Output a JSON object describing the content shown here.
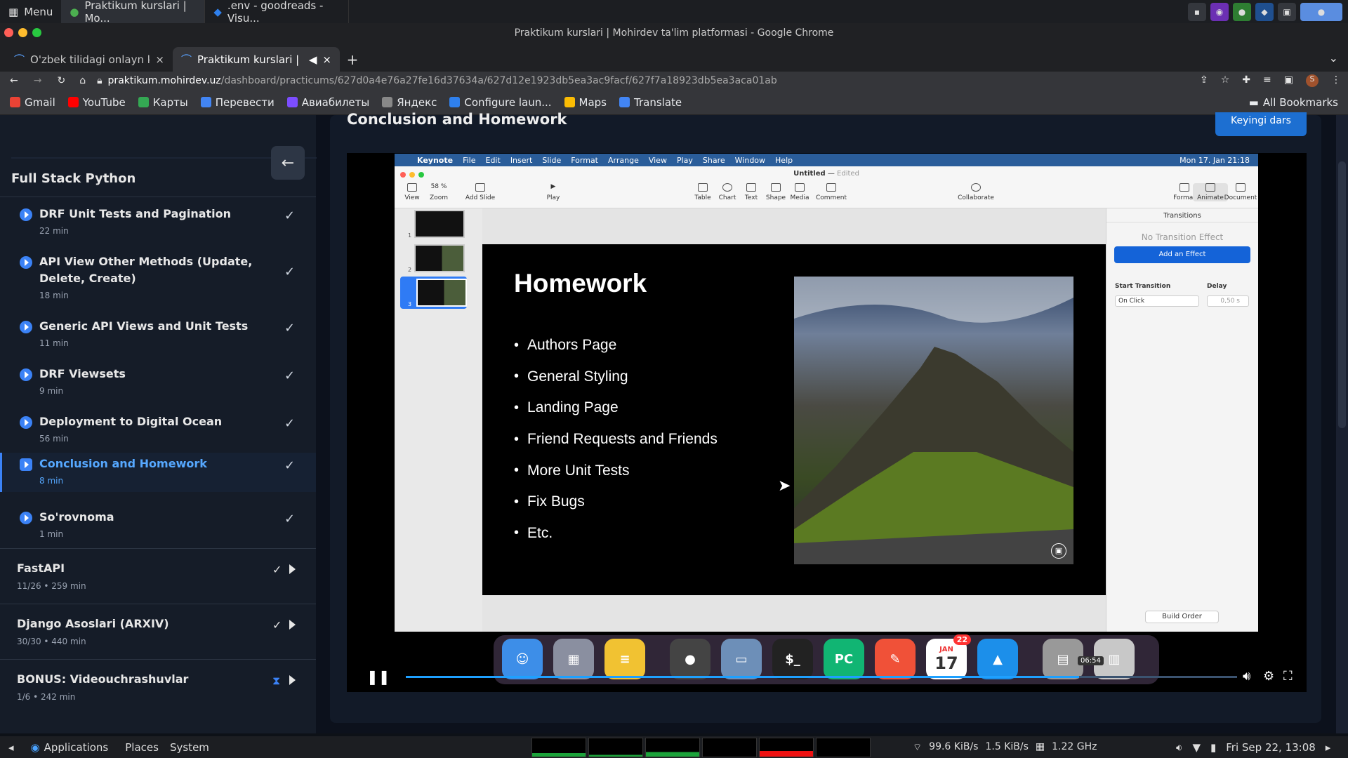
{
  "os_panel": {
    "menu_label": "Menu",
    "tasks": [
      "Praktikum kurslari | Mo...",
      ".env - goodreads - Visu..."
    ]
  },
  "window_title": "Praktikum kurslari | Mohirdev ta'lim platformasi - Google Chrome",
  "tabs": [
    {
      "label": "O'zbek tilidagi onlayn kur",
      "close": "×"
    },
    {
      "label": "Praktikum kurslari | M",
      "close": "×"
    }
  ],
  "new_tab": "+",
  "address": {
    "host": "praktikum.mohirdev.uz",
    "path": "/dashboard/practicums/627d0a4e76a27fe16d37634a/627d12e1923db5ea3ac9facf/627f7a18923db5ea3aca01ab"
  },
  "bookmarks": [
    {
      "label": "Gmail",
      "color": "#ea4335"
    },
    {
      "label": "YouTube",
      "color": "#ff0000"
    },
    {
      "label": "Карты",
      "color": "#34a853"
    },
    {
      "label": "Перевести",
      "color": "#4285f4"
    },
    {
      "label": "Авиабилеты",
      "color": "#7c4dff"
    },
    {
      "label": "Яндекс",
      "color": "#888888"
    },
    {
      "label": "Configure laun...",
      "color": "#2f80ed"
    },
    {
      "label": "Maps",
      "color": "#fbbc04"
    },
    {
      "label": "Translate",
      "color": "#4285f4"
    }
  ],
  "all_bookmarks": "All Bookmarks",
  "sidebar": {
    "title": "Full Stack Python",
    "lessons": [
      {
        "title": "DRF Unit Tests and Pagination",
        "duration": "22 min"
      },
      {
        "title": "API View Other Methods (Update, Delete, Create)",
        "duration": "18 min"
      },
      {
        "title": "Generic API Views and Unit Tests",
        "duration": "11 min"
      },
      {
        "title": "DRF Viewsets",
        "duration": "9 min"
      },
      {
        "title": "Deployment to Digital Ocean",
        "duration": "56 min"
      },
      {
        "title": "Conclusion and Homework",
        "duration": "8 min",
        "active": true
      },
      {
        "title": "So'rovnoma",
        "duration": "1 min"
      }
    ],
    "sections": [
      {
        "title": "FastAPI",
        "meta": "11/26 • 259 min",
        "mark": "✓"
      },
      {
        "title": "Django Asoslari (ARXIV)",
        "meta": "30/30 • 440 min",
        "mark": "✓"
      },
      {
        "title": "BONUS: Videouchrashuvlar",
        "meta": "1/6 • 242 min",
        "mark": "⧗"
      }
    ]
  },
  "main": {
    "heading": "Conclusion and Homework",
    "next_button": "Keyingi dars"
  },
  "keynote": {
    "menubar": [
      "Keynote",
      "File",
      "Edit",
      "Insert",
      "Slide",
      "Format",
      "Arrange",
      "View",
      "Play",
      "Share",
      "Window",
      "Help"
    ],
    "clock": "Mon 17. Jan 21:18",
    "doc_title": "Untitled",
    "doc_state": "Edited",
    "toolbar": {
      "view": "View",
      "zoom_value": "58 %",
      "zoom": "Zoom",
      "add_slide": "Add Slide",
      "play": "Play",
      "table": "Table",
      "chart": "Chart",
      "text": "Text",
      "shape": "Shape",
      "media": "Media",
      "comment": "Comment",
      "collaborate": "Collaborate",
      "format": "Format",
      "animate": "Animate",
      "document": "Document"
    },
    "slide": {
      "title": "Homework",
      "bullets": [
        "Authors Page",
        "General Styling",
        "Landing Page",
        "Friend Requests and Friends",
        "More Unit Tests",
        "Fix Bugs",
        "Etc."
      ]
    },
    "inspector": {
      "header": "Transitions",
      "no_effect": "No Transition Effect",
      "add_effect": "Add an Effect",
      "start_label": "Start Transition",
      "start_value": "On Click",
      "delay_label": "Delay",
      "delay_value": "0,50 s",
      "build_order": "Build Order"
    },
    "thumbnail_numbers": [
      "1",
      "2",
      "3"
    ]
  },
  "dock": [
    {
      "name": "Finder",
      "color": "#3d8ee8"
    },
    {
      "name": "Launchpad",
      "color": "#8a8fa0"
    },
    {
      "name": "Notes",
      "color": "#f1c232"
    },
    {
      "name": "Chrome",
      "color": "#4a4a4a"
    },
    {
      "name": "Preview",
      "color": "#6d8fb8"
    },
    {
      "name": "Terminal",
      "color": "#222222",
      "label": "$_"
    },
    {
      "name": "PyCharm",
      "color": "#11b573",
      "label": "PC"
    },
    {
      "name": "Swift",
      "color": "#f05138"
    },
    {
      "name": "Calendar",
      "color": "#ffffff",
      "label": "17"
    },
    {
      "name": "Keynote",
      "color": "#1c8fea"
    },
    {
      "name": "Screenshots",
      "color": "#999999"
    },
    {
      "name": "Trash",
      "color": "#c8c8c8"
    }
  ],
  "calendar_badge": "22",
  "calendar_month": "JAN",
  "player": {
    "time_tooltip": "06:54",
    "progress": 0.81
  },
  "os_bottom": {
    "applications": "Applications",
    "places": "Places",
    "system": "System",
    "net": "99.6 KiB/s",
    "net2": "1.5 KiB/s",
    "cpu": "1.22 GHz",
    "clock": "Fri Sep 22, 13:08"
  }
}
